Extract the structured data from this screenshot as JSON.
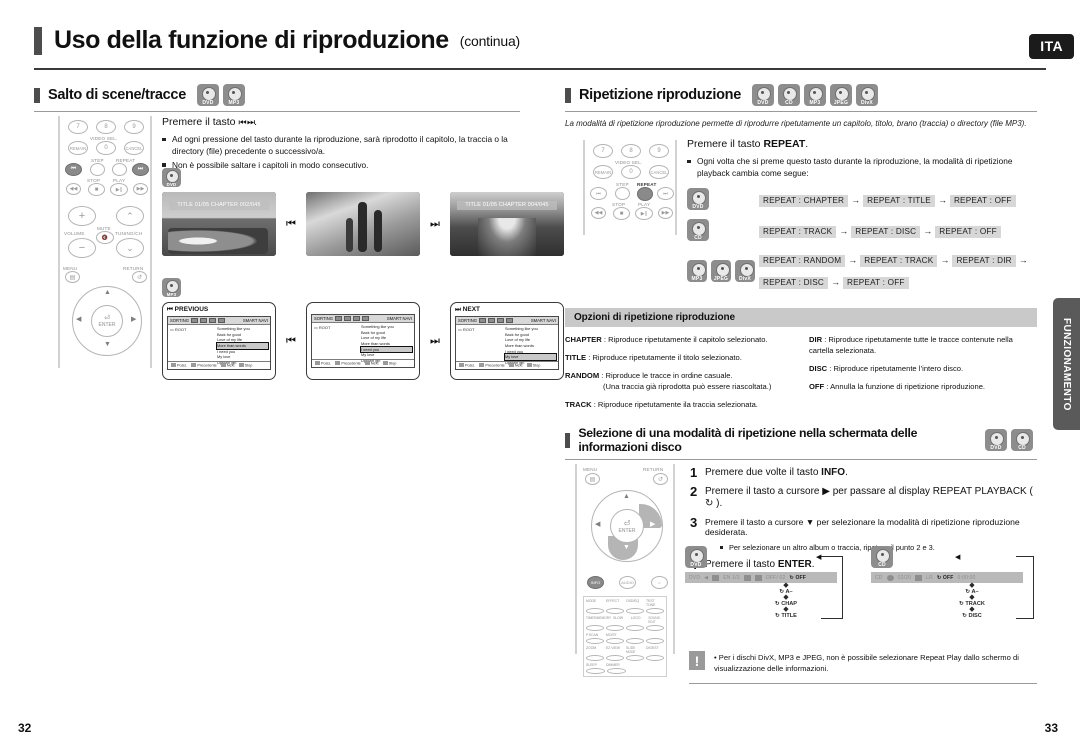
{
  "document": {
    "title": "Uso della funzione di riproduzione",
    "title_suffix": "(continua)",
    "language_badge": "ITA",
    "side_tab": "FUNZIONAMENTO",
    "page_left": "32",
    "page_right": "33"
  },
  "left_column": {
    "section": {
      "title": "Salto di scene/tracce",
      "disc_icons": [
        "DVD",
        "MP3"
      ]
    },
    "press_line": "Premere il tasto",
    "press_symbols": "⏮ ⏭",
    "bullets": [
      "Ad ogni pressione del tasto durante la riproduzione, sarà riprodotto il capitolo, la traccia o la directory (file) precedente o successivo/a.",
      "Non è possibile saltare i capitoli in modo consecutivo."
    ],
    "dvd_example": {
      "badge": "DVD",
      "screens": [
        {
          "osd": "TITLE 01/05 CHAPTER 002/045"
        },
        {
          "osd": ""
        },
        {
          "osd": "TITLE 01/05 CHAPTER 004/045"
        }
      ],
      "left_symbol": "⏮",
      "right_symbol": "⏭"
    },
    "mp3_example": {
      "badge": "MP3",
      "screens": [
        {
          "label": "PREVIOUS",
          "label_symbol": "⏮",
          "selected_index": 3
        },
        {
          "label": "",
          "label_symbol": "",
          "selected_index": 4
        },
        {
          "label": "NEXT",
          "label_symbol": "⏭",
          "selected_index": 5
        }
      ],
      "sorting_label": "SORTING",
      "smartnavi_label": "SMART NAVI",
      "root_label": "ROOT",
      "tracks": [
        "Something like you",
        "Back for good",
        "Love of my life",
        "More than words",
        "I need you",
        "My love",
        "Uptown girl"
      ],
      "footer_buttons": [
        "Posiz.",
        "Precedente",
        "Next",
        "Stop"
      ],
      "left_symbol": "⏮",
      "right_symbol": "⏭"
    },
    "remote": {
      "numbers": [
        "7",
        "8",
        "9",
        "REMAIN",
        "0",
        "CANCEL"
      ],
      "label_video_sel": "VIDEO SEL.",
      "label_step": "STEP",
      "label_repeat": "REPEAT",
      "label_stop": "STOP",
      "label_play": "PLAY",
      "label_volume": "VOLUME",
      "label_mute": "MUTE",
      "label_tuning": "TUNING/CH",
      "label_menu": "MENU",
      "label_return": "RETURN",
      "label_enter": "ENTER",
      "highlight": [
        "skip-back",
        "skip-forward"
      ]
    }
  },
  "right_column": {
    "section": {
      "title": "Ripetizione riproduzione",
      "disc_icons": [
        "DVD",
        "CD",
        "MP3",
        "JPEG",
        "DivX"
      ],
      "intro": "La modalità di ripetizione riproduzione permette di riprodurre ripetutamente un capitolo, titolo, brano (traccia) o directory (file MP3)."
    },
    "press_line_prefix": "Premere il tasto ",
    "press_line_key": "REPEAT",
    "press_line_suffix": ".",
    "bullet": "Ogni volta che si preme questo tasto durante la riproduzione, la modalità di ripetizione playback cambia come segue:",
    "sequences": [
      {
        "icons": [
          "DVD"
        ],
        "lines": [
          [
            "REPEAT : CHAPTER",
            "REPEAT : TITLE",
            "REPEAT : OFF"
          ]
        ]
      },
      {
        "icons": [
          "CD"
        ],
        "lines": [
          [
            "REPEAT : TRACK",
            "REPEAT : DISC",
            "REPEAT : OFF"
          ]
        ]
      },
      {
        "icons": [
          "MP3",
          "JPEG",
          "DivX"
        ],
        "lines": [
          [
            "REPEAT : RANDOM",
            "REPEAT : TRACK",
            "REPEAT : DIR"
          ],
          [
            "REPEAT : DISC",
            "REPEAT : OFF"
          ]
        ]
      }
    ],
    "arrow": "→",
    "options": {
      "header": "Opzioni di ripetizione riproduzione",
      "left": [
        {
          "term": "CHAPTER",
          "desc": ": Riproduce ripetutamente il capitolo selezionato.",
          "sub": ""
        },
        {
          "term": "TITLE",
          "desc": ": Riproduce ripetutamente il titolo selezionato.",
          "sub": ""
        },
        {
          "term": "RANDOM",
          "desc": ": Riproduce le tracce in ordine casuale.",
          "sub": "(Una traccia già riprodotta può essere riascoltata.)"
        },
        {
          "term": "TRACK",
          "desc": ": Riproduce ripetutamente ila traccia selezionata.",
          "sub": ""
        }
      ],
      "right": [
        {
          "term": "DIR",
          "desc": ": Riproduce ripetutamente tutte le tracce contenute nella cartella selezionata.",
          "sub": ""
        },
        {
          "term": "DISC",
          "desc": ": Riproduce ripetutamente l’intero disco.",
          "sub": ""
        },
        {
          "term": "OFF",
          "desc": ": Annulla la funzione di ripetizione riproduzione.",
          "sub": ""
        }
      ]
    },
    "info_section": {
      "title": "Selezione di una modalità di ripetizione nella schermata delle informazioni disco",
      "disc_icons": [
        "DVD",
        "CD"
      ],
      "steps": [
        {
          "num": "1",
          "text_html": "Premere due volte il tasto <b>INFO</b>."
        },
        {
          "num": "2",
          "text_html": "Premere il tasto a cursore ▶ per passare al display REPEAT PLAYBACK ( ↻ )."
        },
        {
          "num": "3",
          "text_html": "Premere il tasto a cursore ▼ per selezionare la modalità di ripetizione riproduzione desiderata."
        },
        {
          "num": "4",
          "text_html": "Premere il tasto <b>ENTER</b>."
        }
      ],
      "substep": "Per selezionare un altro album o traccia, ripetere il punto 2 e 3.",
      "remote": {
        "label_menu": "MENU",
        "label_return": "RETURN",
        "label_enter": "ENTER",
        "label_info": "INFO",
        "label_audio": "AUDIO",
        "label_subtitle": "SUBTITLE",
        "keypad_rows": [
          [
            "MODE",
            "EFFECT",
            "OSD/EQ",
            "TEST TONE"
          ],
          [
            "TIMER/MEMORY",
            "SLOW",
            "LOGO",
            "SOUND EDIT"
          ],
          [
            "P.SCAN",
            "MO/ST",
            "",
            ""
          ],
          [
            "ZOOM",
            "EZ VIEW",
            "SLIDE MODE",
            "DIGEST"
          ],
          [
            "",
            "RETURN",
            "",
            ""
          ],
          [
            "SLEEP",
            "DIMMER",
            "",
            ""
          ]
        ]
      },
      "diagrams": [
        {
          "badge": "DVD",
          "osd": [
            "DVD",
            "◀",
            "EN 1/3",
            "OFF/ 02"
          ],
          "items": [
            "OFF",
            "A–",
            "CHAP",
            "TITLE"
          ],
          "loop_icon": "↻"
        },
        {
          "badge": "CD",
          "osd": [
            "CD",
            "02/20",
            "LR",
            "0:00:00"
          ],
          "items": [
            "OFF",
            "A–",
            "TRACK",
            "DISC"
          ],
          "loop_icon": "↻"
        }
      ],
      "note": "Per i dischi DivX, MP3 e JPEG, non è possibile selezionare Repeat Play dallo schermo di visualizzazione delle informazioni.",
      "note_icon": "!"
    }
  }
}
